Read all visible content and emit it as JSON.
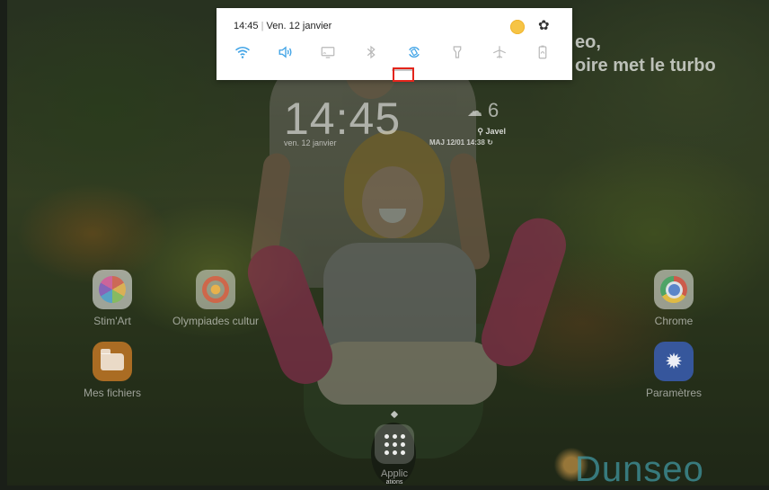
{
  "wallpaper": {
    "text_line1": "eo,",
    "text_line2": "oire met le turbo",
    "brand": "Dunseo"
  },
  "lockscreen_widget": {
    "time": "14:45",
    "date": "ven. 12 janvier",
    "temperature": "6",
    "location": "Javel",
    "updated": "MAJ 12/01 14:38"
  },
  "quick_panel": {
    "time": "14:45",
    "separator": "|",
    "date": "Ven. 12 janvier",
    "toggles": [
      {
        "name": "wifi",
        "state": "on"
      },
      {
        "name": "sound",
        "state": "on"
      },
      {
        "name": "screen-mirroring",
        "state": "off"
      },
      {
        "name": "bluetooth",
        "state": "off"
      },
      {
        "name": "auto-rotate",
        "state": "on"
      },
      {
        "name": "flashlight",
        "state": "off"
      },
      {
        "name": "airplane-mode",
        "state": "off"
      },
      {
        "name": "power-saving",
        "state": "off"
      }
    ],
    "accent_color": "#3fa3e6"
  },
  "home": {
    "apps": [
      {
        "id": "stimart",
        "label": "Stim'Art"
      },
      {
        "id": "olympiades",
        "label": "Olympiades cultur"
      },
      {
        "id": "files",
        "label": "Mes fichiers"
      },
      {
        "id": "chrome",
        "label": "Chrome"
      },
      {
        "id": "settings",
        "label": "Paramètres"
      }
    ],
    "apps_button_label": "Applic",
    "apps_button_sublabel": "ations"
  },
  "annotation": {
    "color": "#e3241b"
  }
}
